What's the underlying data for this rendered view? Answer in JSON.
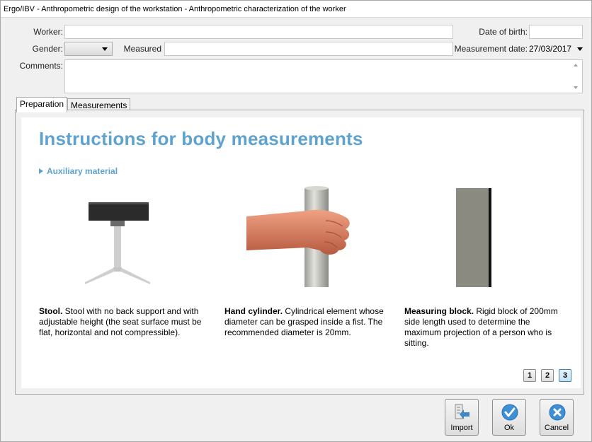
{
  "window": {
    "title": "Ergo/IBV - Anthropometric design of the workstation - Anthropometric characterization of the worker"
  },
  "form": {
    "worker_label": "Worker:",
    "worker_value": "",
    "dob_label": "Date of birth:",
    "dob_value": "",
    "gender_label": "Gender:",
    "gender_value": "",
    "measured_label": "Measured",
    "measured_value": "",
    "measurement_date_label": "Measurement date:",
    "measurement_date_value": "27/03/2017",
    "comments_label": "Comments:",
    "comments_value": ""
  },
  "tabs": [
    {
      "label": "Preparation",
      "active": true
    },
    {
      "label": "Measurements",
      "active": false
    }
  ],
  "content": {
    "heading": "Instructions for body measurements",
    "section": "Auxiliary material",
    "items": [
      {
        "icon": "stool",
        "title": "Stool.",
        "text": " Stool with no back support and with adjustable height (the seat surface must be flat, horizontal and not compressible)."
      },
      {
        "icon": "hand-cylinder",
        "title": "Hand cylinder.",
        "text": " Cylindrical element whose diameter can be grasped inside a fist. The recommended diameter is 20mm."
      },
      {
        "icon": "measuring-block",
        "title": "Measuring block.",
        "text": " Rigid block of 200mm side length used to determine the maximum projection of a person who is sitting."
      }
    ],
    "pages": [
      "1",
      "2",
      "3"
    ],
    "active_page": "3"
  },
  "buttons": {
    "import": "Import",
    "ok": "Ok",
    "cancel": "Cancel"
  },
  "colors": {
    "accent": "#5ea2d0",
    "ok_icon": "#3d8fd6",
    "cancel_icon": "#3d8fd6"
  }
}
